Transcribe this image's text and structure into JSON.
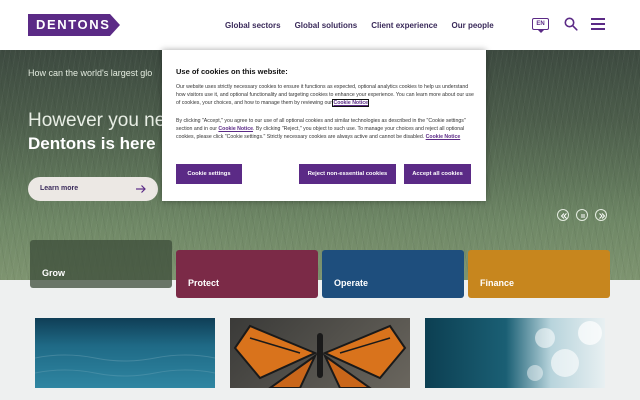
{
  "header": {
    "logo_text": "DENTONS",
    "nav": [
      "Global sectors",
      "Global solutions",
      "Client experience",
      "Our people"
    ],
    "language": "EN"
  },
  "hero": {
    "kicker": "How can the world's largest glo",
    "line1": "However you nee",
    "line2": "Dentons is here",
    "cta_label": "Learn more"
  },
  "tiles": [
    {
      "label": "Grow",
      "color": "#4a5e48"
    },
    {
      "label": "Protect",
      "color": "#7b2a47"
    },
    {
      "label": "Operate",
      "color": "#1e4e7d"
    },
    {
      "label": "Finance",
      "color": "#c7861e"
    }
  ],
  "cookie": {
    "title": "Use of cookies on this website:",
    "p1_a": "Our website uses strictly necessary cookies to ensure it functions as expected, optional analytics cookies to help us understand how visitors use it, and optional functionality and targeting cookies to enhance your experience. You can learn more about our use of cookies, your choices, and how to manage them by reviewing our ",
    "p1_link": "Cookie Notice",
    "p2_a": "By clicking \"Accept,\" you agree to our use of all optional cookies and similar technologies as described in the \"Cookie settings\" section and in our ",
    "p2_link": "Cookie Notice",
    "p2_b": ". By clicking \"Reject,\" you object to such use. To manage your choices and reject all optional cookies, please click \"Cookie settings.\" Strictly necessary cookies are always active and cannot be disabled.",
    "p2_link2": "Cookie Notice",
    "btn_settings": "Cookie settings",
    "btn_reject": "Reject non-essential cookies",
    "btn_accept": "Accept all cookies"
  },
  "colors": {
    "brand_purple": "#5b2a86"
  }
}
